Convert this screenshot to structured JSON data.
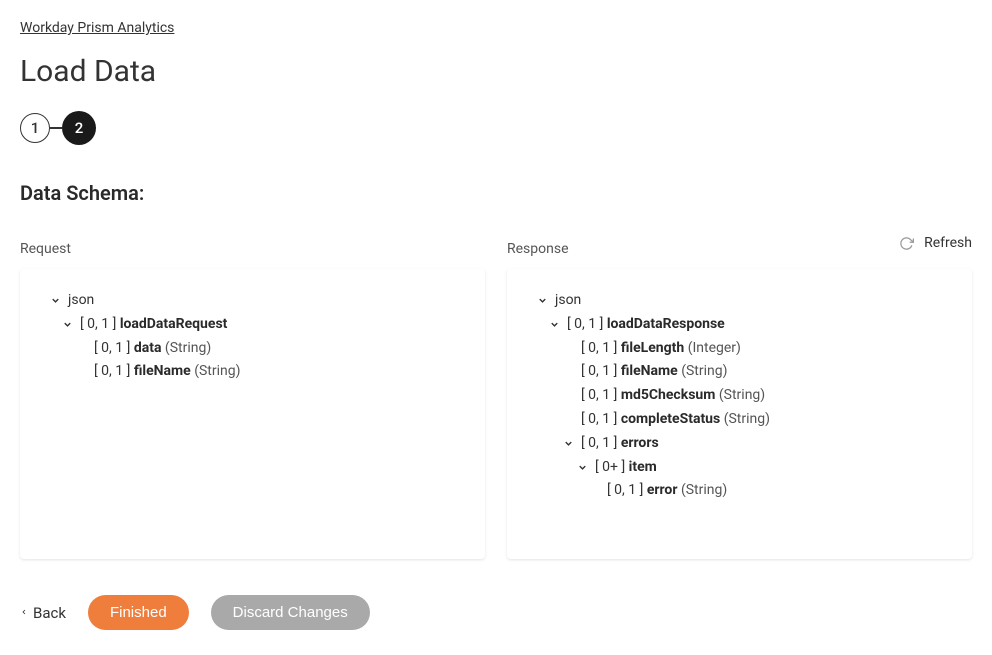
{
  "breadcrumb": "Workday Prism Analytics",
  "page_title": "Load Data",
  "stepper": {
    "step1": "1",
    "step2": "2"
  },
  "section_title": "Data Schema:",
  "refresh_label": "Refresh",
  "columns": {
    "request_label": "Request",
    "response_label": "Response"
  },
  "request_tree": {
    "root": "json",
    "loadDataRequest": {
      "cardinality": "[ 0, 1 ]",
      "name": "loadDataRequest"
    },
    "data": {
      "cardinality": "[ 0, 1 ]",
      "name": "data",
      "type": "(String)"
    },
    "fileName": {
      "cardinality": "[ 0, 1 ]",
      "name": "fileName",
      "type": "(String)"
    }
  },
  "response_tree": {
    "root": "json",
    "loadDataResponse": {
      "cardinality": "[ 0, 1 ]",
      "name": "loadDataResponse"
    },
    "fileLength": {
      "cardinality": "[ 0, 1 ]",
      "name": "fileLength",
      "type": "(Integer)"
    },
    "fileName": {
      "cardinality": "[ 0, 1 ]",
      "name": "fileName",
      "type": "(String)"
    },
    "md5Checksum": {
      "cardinality": "[ 0, 1 ]",
      "name": "md5Checksum",
      "type": "(String)"
    },
    "completeStatus": {
      "cardinality": "[ 0, 1 ]",
      "name": "completeStatus",
      "type": "(String)"
    },
    "errors": {
      "cardinality": "[ 0, 1 ]",
      "name": "errors"
    },
    "item": {
      "cardinality": "[ 0+ ]",
      "name": "item"
    },
    "error": {
      "cardinality": "[ 0, 1 ]",
      "name": "error",
      "type": "(String)"
    }
  },
  "footer": {
    "back": "Back",
    "finished": "Finished",
    "discard": "Discard Changes"
  }
}
